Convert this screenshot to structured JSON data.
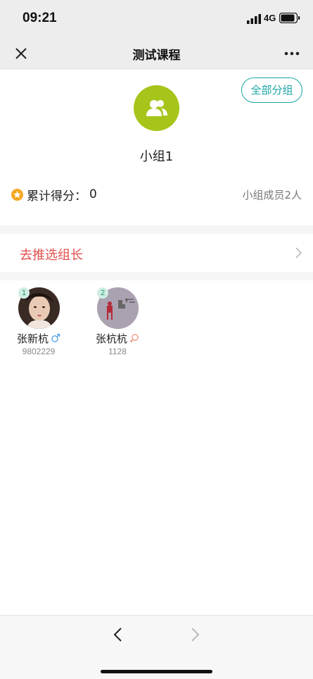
{
  "status_bar": {
    "time": "09:21",
    "network": "4G"
  },
  "nav": {
    "title": "测试课程",
    "close_icon": "close-icon",
    "more_icon": "more-icon"
  },
  "group": {
    "all_groups_label": "全部分组",
    "name": "小组1",
    "score_label": "累计得分：",
    "score_value": "0",
    "member_count": "小组成员2人",
    "avatar_color": "#a6c51a"
  },
  "elect": {
    "label": "去推选组长",
    "label_color": "#e0514f"
  },
  "members": [
    {
      "rank": "1",
      "name": "张新杭",
      "gender": "male",
      "id": "9802229"
    },
    {
      "rank": "2",
      "name": "张杭杭",
      "gender": "female",
      "id": "1128"
    }
  ],
  "colors": {
    "accent": "#1aa5a5",
    "male": "#4a9ee8",
    "female": "#f2917b",
    "star": "#f5a623"
  }
}
